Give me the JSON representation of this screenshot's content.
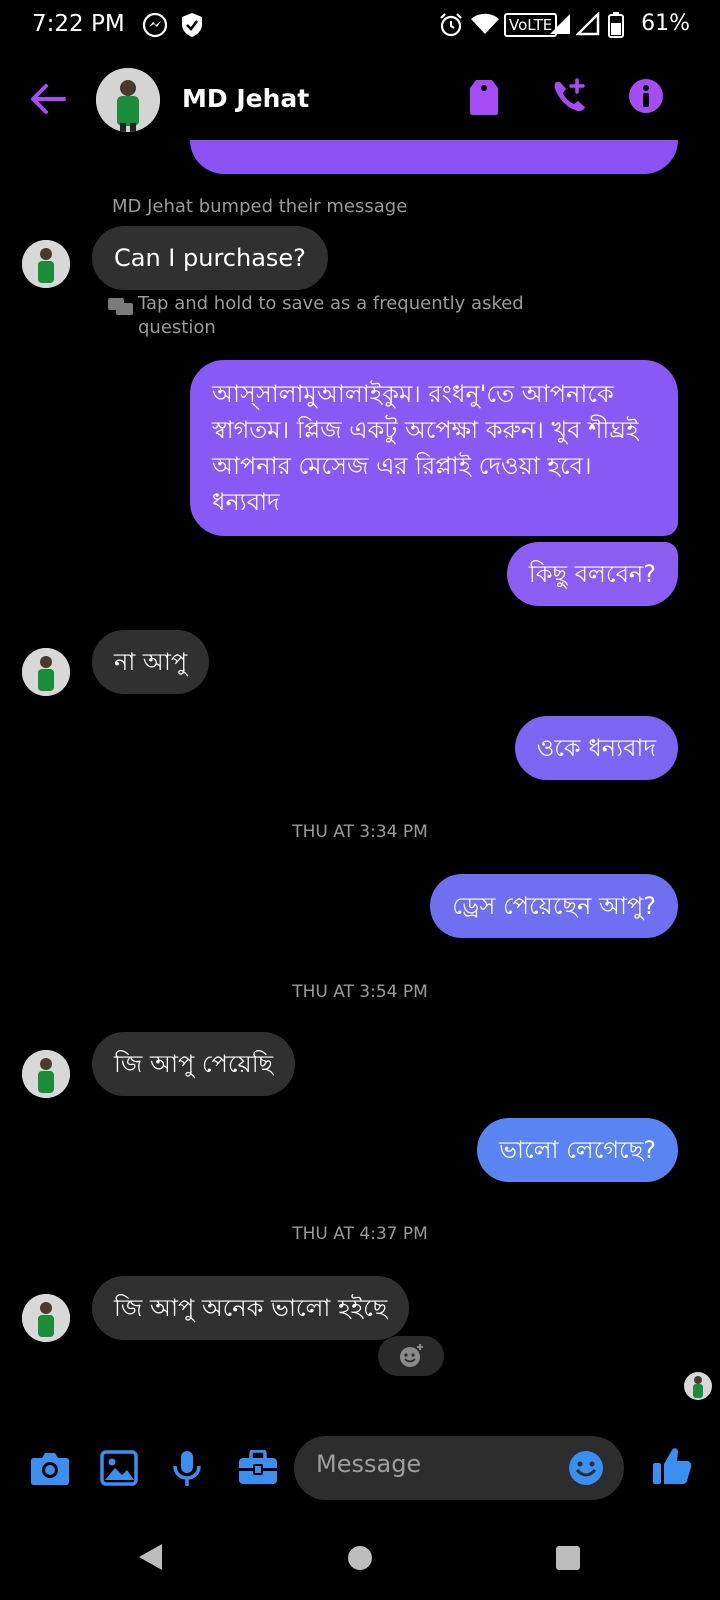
{
  "status_bar": {
    "time": "7:22 PM",
    "volte": "VoLTE",
    "battery": "61%",
    "icons": [
      "messenger-icon",
      "shield-icon",
      "alarm-icon",
      "wifi-icon",
      "signal-icon",
      "signal-icon-2",
      "battery-icon"
    ]
  },
  "header": {
    "contact_name": "MD Jehat",
    "icons": [
      "back-arrow-icon",
      "tag-icon",
      "add-call-icon",
      "info-icon"
    ]
  },
  "chat": {
    "bump_notice": "MD Jehat bumped their message",
    "faq_hint": "Tap and hold to save as a frequently asked question",
    "messages": [
      {
        "text": "Can I purchase?"
      },
      {
        "text": "আস্সালামুআলাইকুম। রংধনু'তে আপনাকে স্বাগতম। প্লিজ একটু অপেক্ষা করুন। খুব শীঘ্রই আপনার মেসেজ এর রিপ্লাই দেওয়া হবে। ধন্যবাদ"
      },
      {
        "text": "কিছু বলবেন?"
      },
      {
        "text": "না আপু"
      },
      {
        "text": "ওকে ধন্যবাদ"
      },
      {
        "text": "ড্রেস পেয়েছেন আপু?"
      },
      {
        "text": "জি আপু পেয়েছি"
      },
      {
        "text": "ভালো লেগেছে?"
      },
      {
        "text": "জি আপু অনেক ভালো হইছে"
      }
    ],
    "timestamps": [
      "THU AT 3:34 PM",
      "THU AT 3:54 PM",
      "THU AT 4:37 PM"
    ],
    "colors": {
      "purple_1": "#8b51f5",
      "purple_2": "#8859f4",
      "purple_3": "#7d65f4",
      "blue_1": "#6f6ff2",
      "blue_2": "#5a84f1",
      "incoming": "#303030",
      "accent": "#a64cf6"
    }
  },
  "composer": {
    "placeholder": "Message",
    "icons": [
      "camera-icon",
      "image-icon",
      "mic-icon",
      "toolbox-icon",
      "emoji-icon",
      "like-icon"
    ]
  },
  "navbar": {
    "icons": [
      "back-nav-icon",
      "home-nav-icon",
      "recents-nav-icon"
    ]
  }
}
